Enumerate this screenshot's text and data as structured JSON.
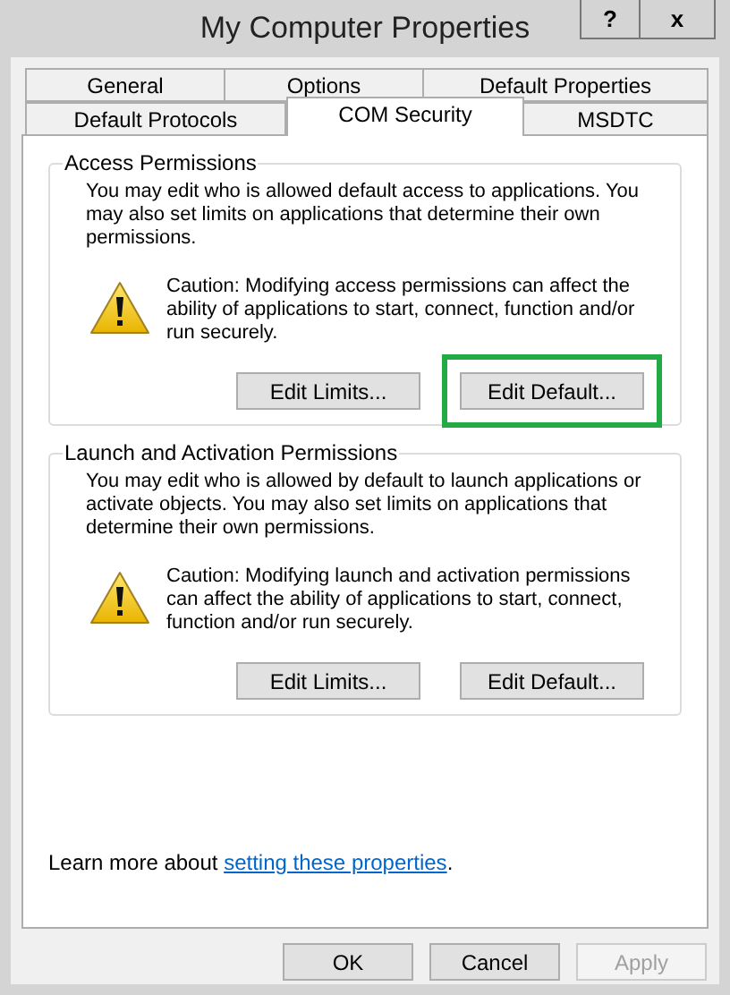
{
  "window": {
    "title": "My Computer Properties",
    "help_button": "?",
    "close_button": "x"
  },
  "tab_rows": [
    [
      {
        "label": "General",
        "selected": false
      },
      {
        "label": "Options",
        "selected": false
      },
      {
        "label": "Default Properties",
        "selected": false
      }
    ],
    [
      {
        "label": "Default Protocols",
        "selected": false
      },
      {
        "label": "COM Security",
        "selected": true
      },
      {
        "label": "MSDTC",
        "selected": false
      }
    ]
  ],
  "groups": [
    {
      "title": "Access Permissions",
      "description": "You may edit who is allowed default access to applications. You may also set limits on applications that determine their own permissions.",
      "caution": "Caution: Modifying access permissions can affect the ability of applications to start, connect, function and/or run securely.",
      "buttons": [
        {
          "label": "Edit Limits...",
          "highlighted": false
        },
        {
          "label": "Edit Default...",
          "highlighted": true
        }
      ]
    },
    {
      "title": "Launch and Activation Permissions",
      "description": "You may edit who is allowed by default to launch applications or activate objects. You may also set limits on applications that determine their own permissions.",
      "caution": "Caution: Modifying launch and activation permissions can affect the ability of applications to start, connect, function and/or run securely.",
      "buttons": [
        {
          "label": "Edit Limits...",
          "highlighted": false
        },
        {
          "label": "Edit Default...",
          "highlighted": false
        }
      ]
    }
  ],
  "footer": {
    "text": "Learn more about ",
    "link": "setting these properties",
    "after": "."
  },
  "dialog_buttons": [
    {
      "label": "OK",
      "disabled": false
    },
    {
      "label": "Cancel",
      "disabled": false
    },
    {
      "label": "Apply",
      "disabled": true
    }
  ]
}
